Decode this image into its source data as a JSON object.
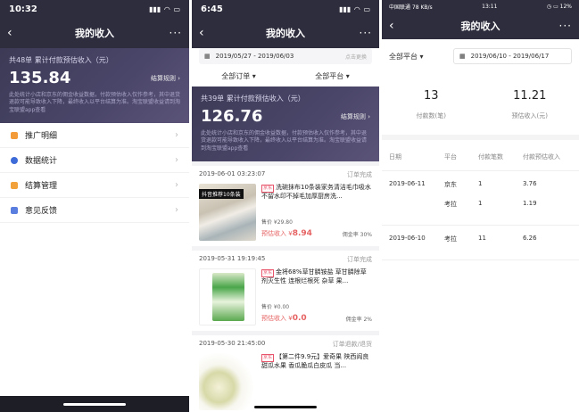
{
  "phone1": {
    "time": "10:32",
    "title": "我的收入",
    "summary_label": "共48单 累计付款预估收入（元）",
    "amount": "135.84",
    "rule_label": "结算规则",
    "note": "此处统计小店和京东的佣金收益数据，付款预估收入仅作参考，其中退货退款可能导致收入下降，最终收入以平台结算为准。淘宝联盟收益请到淘宝联盟app查看",
    "menu": [
      {
        "label": "推广明细",
        "color": "#f29b38"
      },
      {
        "label": "数据统计",
        "color": "#3d6bd8"
      },
      {
        "label": "结算管理",
        "color": "#f2a23a"
      },
      {
        "label": "意见反馈",
        "color": "#5a7de0"
      }
    ]
  },
  "phone2": {
    "time": "6:45",
    "title": "我的收入",
    "date_range": "2019/05/27 - 2019/06/03",
    "change_label": "点击更换",
    "filter_orders": "全部订单",
    "filter_platform": "全部平台",
    "summary_label": "共39单 累计付款预估收入（元）",
    "amount": "126.76",
    "rule_label": "结算规则",
    "note": "此处统计小店和京东的佣金收益数据，付款预估收入仅作参考，其中退货退款可能导致收入下降，最终收入以平台结算为准。淘宝联盟收益请到淘宝联盟app查看",
    "orders": [
      {
        "time": "2019-06-01 03:23:07",
        "status": "订单完成",
        "src": "京东",
        "title": "洗碗抹布10条装家务清洁毛巾吸水不留水印不掉毛加厚厨房洗...",
        "price": "售价 ¥29.80",
        "est_label": "预估收入 ¥",
        "est": "8.94",
        "rate": "佣金率 30%",
        "tag": "抖音推荐10条装"
      },
      {
        "time": "2019-05-31 19:19:45",
        "status": "订单完成",
        "src": "京东",
        "title": "金将68%草甘膦铵盐 草甘膦除草剂灭生性 连根烂根死 杂草 果...",
        "price": "售价 ¥0.00",
        "est_label": "预估收入 ¥",
        "est": "0.0",
        "rate": "佣金率 2%",
        "tag": ""
      },
      {
        "time": "2019-05-30 21:45:00",
        "status": "订单退款/退货",
        "src": "京东",
        "title": "【第二件9.9元】爱奇果 陕西阎良甜瓜水果 香瓜脆瓜白皮瓜 当...",
        "price": "",
        "est_label": "",
        "est": "",
        "rate": "",
        "tag": ""
      }
    ]
  },
  "phone3": {
    "status_left": "中国联通 78 KB/s",
    "time": "13:11",
    "status_right": "12%",
    "title": "我的收入",
    "filter_platform": "全部平台",
    "date_range": "2019/06/10 - 2019/06/17",
    "stats": [
      {
        "value": "13",
        "caption": "付款数(笔)"
      },
      {
        "value": "11.21",
        "caption": "预估收入(元)"
      }
    ],
    "columns": [
      "日期",
      "平台",
      "付款笔数",
      "付款预估收入"
    ],
    "groups": [
      {
        "date": "2019-06-11",
        "rows": [
          {
            "platform": "京东",
            "count": "1",
            "amount": "3.76"
          },
          {
            "platform": "考拉",
            "count": "1",
            "amount": "1.19"
          }
        ]
      },
      {
        "date": "2019-06-10",
        "rows": [
          {
            "platform": "考拉",
            "count": "11",
            "amount": "6.26"
          }
        ]
      }
    ]
  }
}
